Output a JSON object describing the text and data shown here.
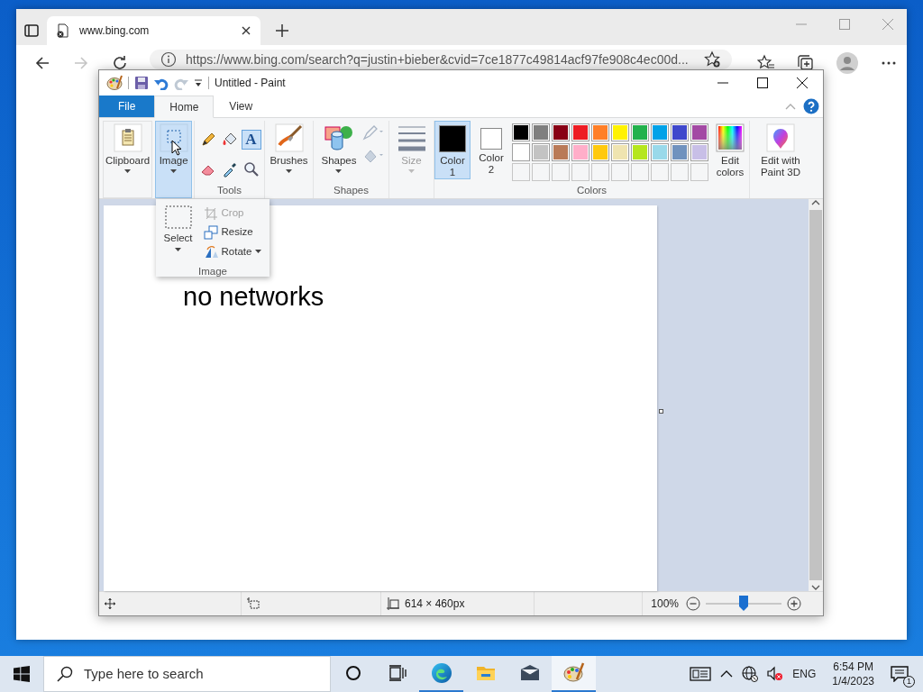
{
  "browser": {
    "tab": {
      "title": "www.bing.com"
    },
    "nav": [
      {
        "kind": "back",
        "disabled": false
      },
      {
        "kind": "forward",
        "disabled": true
      },
      {
        "kind": "refresh",
        "disabled": false
      }
    ],
    "address": "https://www.bing.com/search?q=justin+bieber&cvid=7ce1877c49814acf97fe908c4ec00d..."
  },
  "paint": {
    "title": "Untitled - Paint",
    "quick_access": [
      {
        "kind": "save",
        "disabled": false
      },
      {
        "kind": "undo",
        "disabled": false
      },
      {
        "kind": "redo",
        "disabled": true
      }
    ],
    "tabs": [
      {
        "label": "File",
        "kind": "file",
        "selected": false
      },
      {
        "label": "Home",
        "kind": "tab",
        "selected": true
      },
      {
        "label": "View",
        "kind": "tab",
        "selected": false
      }
    ],
    "ribbon": {
      "clipboard": {
        "label": "Clipboard",
        "selected": false
      },
      "image": {
        "label": "Image",
        "selected": true
      },
      "tools": {
        "label": "Tools",
        "items": [
          {
            "kind": "pencil",
            "selected": false
          },
          {
            "kind": "fill",
            "selected": false
          },
          {
            "kind": "text",
            "selected": true,
            "glyph": "A"
          },
          {
            "kind": "eraser",
            "selected": false
          },
          {
            "kind": "picker",
            "selected": false
          },
          {
            "kind": "magnifier",
            "selected": false
          }
        ]
      },
      "brushes": "Brushes",
      "shapes": {
        "button": "Shapes",
        "label": "Shapes"
      },
      "size": {
        "label": "Size",
        "disabled": true
      },
      "colors": {
        "label": "Colors",
        "color1": {
          "label": "Color 1",
          "color": "#000000",
          "selected": true
        },
        "color2": {
          "label": "Color 2",
          "color": "#ffffff",
          "selected": false
        },
        "palette": [
          {
            "color": "#000000"
          },
          {
            "color": "#7f7f7f"
          },
          {
            "color": "#880015"
          },
          {
            "color": "#ed1c24"
          },
          {
            "color": "#ff7f27"
          },
          {
            "color": "#fff200"
          },
          {
            "color": "#22b14c"
          },
          {
            "color": "#00a2e8"
          },
          {
            "color": "#3f48cc"
          },
          {
            "color": "#a349a4"
          },
          {
            "color": "#ffffff"
          },
          {
            "color": "#c3c3c3"
          },
          {
            "color": "#b97a57"
          },
          {
            "color": "#ffaec9"
          },
          {
            "color": "#ffc90e"
          },
          {
            "color": "#efe4b0"
          },
          {
            "color": "#b5e61d"
          },
          {
            "color": "#99d9ea"
          },
          {
            "color": "#7092be"
          },
          {
            "color": "#c8bfe7"
          }
        ],
        "edit_colors": "Edit colors"
      },
      "paint3d": "Edit with Paint 3D"
    },
    "image_menu": {
      "select": "Select",
      "items": [
        {
          "kind": "crop",
          "label": "Crop",
          "disabled": true
        },
        {
          "kind": "resize",
          "label": "Resize",
          "disabled": false
        },
        {
          "kind": "rotate",
          "label": "Rotate",
          "disabled": false
        }
      ],
      "label": "Image"
    },
    "canvas": {
      "text": "no networks"
    },
    "status": {
      "size": "614 × 460px",
      "zoom": "100%",
      "level": 0.5
    }
  },
  "taskbar": {
    "search": {
      "placeholder": "Type here to search"
    },
    "apps": [
      {
        "kind": "edge",
        "running": true,
        "selected": false
      },
      {
        "kind": "explorer",
        "running": false,
        "selected": false
      },
      {
        "kind": "mail",
        "running": false,
        "selected": false
      },
      {
        "kind": "paint",
        "running": true,
        "selected": true
      }
    ],
    "language": "ENG",
    "time": "6:54 PM",
    "date": "1/4/2023",
    "notifications": "1"
  }
}
